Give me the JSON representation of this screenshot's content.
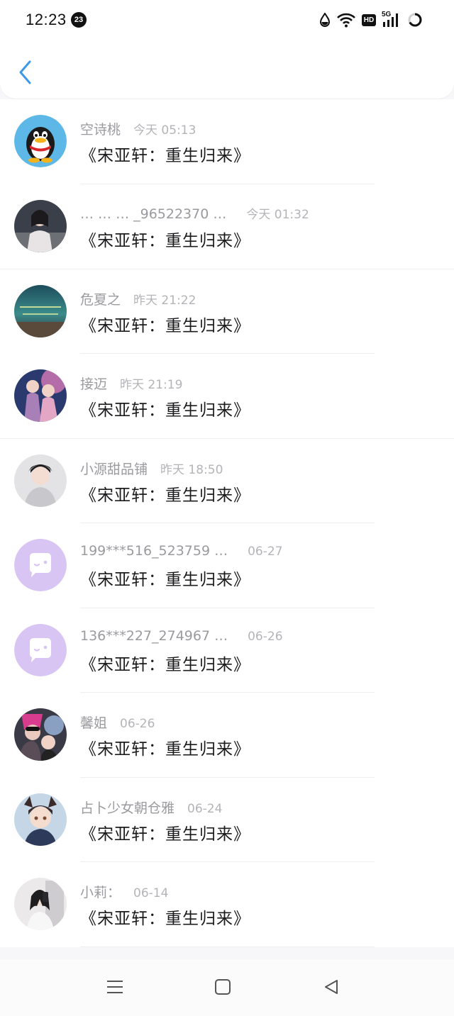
{
  "status_bar": {
    "time": "12:23",
    "notification_count": "23",
    "network_label": "5G",
    "hd_label": "HD"
  },
  "header": {
    "back_icon": "chevron-left-icon",
    "accent_color": "#3d9ae8"
  },
  "messages": [
    {
      "name": "空诗桃",
      "time": "今天 05:13",
      "text": "《宋亚轩：重生归来》",
      "avatar": "qq-penguin"
    },
    {
      "name": "… … … _96522370 …",
      "time": "今天 01:32",
      "text": "《宋亚轩：重生归来》",
      "avatar": "photo"
    },
    {
      "name": "危夏之",
      "time": "昨天 21:22",
      "text": "《宋亚轩：重生归来》",
      "avatar": "photo"
    },
    {
      "name": "接迈",
      "time": "昨天 21:19",
      "text": "《宋亚轩：重生归来》",
      "avatar": "photo"
    },
    {
      "name": "小源甜品铺",
      "time": "昨天 18:50",
      "text": "《宋亚轩：重生归来》",
      "avatar": "photo"
    },
    {
      "name": "199***516_523759 …",
      "time": "06-27",
      "text": "《宋亚轩：重生归来》",
      "avatar": "default-chat"
    },
    {
      "name": "136***227_274967 …",
      "time": "06-26",
      "text": "《宋亚轩：重生归来》",
      "avatar": "default-chat"
    },
    {
      "name": "馨姐",
      "time": "06-26",
      "text": "《宋亚轩：重生归来》",
      "avatar": "photo"
    },
    {
      "name": "占卜少女朝仓雅",
      "time": "06-24",
      "text": "《宋亚轩：重生归来》",
      "avatar": "photo"
    },
    {
      "name": "小莉：",
      "time": "06-14",
      "text": "《宋亚轩：重生归来》",
      "avatar": "photo"
    }
  ],
  "nav_bar": {
    "menu_icon": "menu-icon",
    "home_icon": "home-square-icon",
    "back_icon": "back-triangle-icon"
  }
}
